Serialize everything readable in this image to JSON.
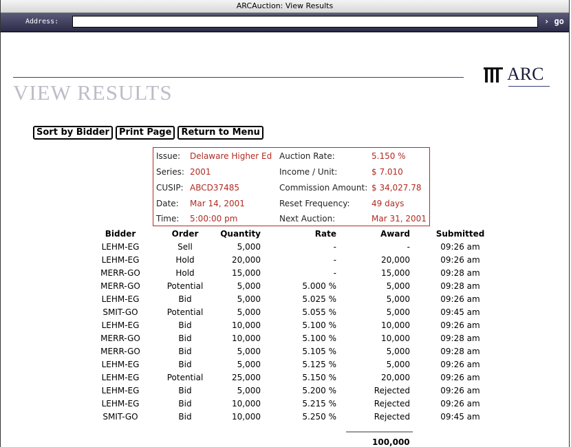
{
  "window": {
    "title": "ARCAuction: View Results"
  },
  "addressbar": {
    "label": "Address:",
    "value": "",
    "go_label": "› go"
  },
  "logo": {
    "text": "ARC"
  },
  "page": {
    "heading": "VIEW RESULTS"
  },
  "buttons": {
    "sort": "Sort by Bidder",
    "print": "Print Page",
    "return": "Return to Menu"
  },
  "info": {
    "issue_label": "Issue:",
    "issue": "Delaware Higher Ed",
    "series_label": "Series:",
    "series": "2001",
    "cusip_label": "CUSIP:",
    "cusip": "ABCD37485",
    "date_label": "Date:",
    "date": "Mar 14, 2001",
    "time_label": "Time:",
    "time": "5:00:00 pm",
    "rate_label": "Auction Rate:",
    "rate": "5.150 %",
    "income_label": "Income / Unit:",
    "income": "$ 7.010",
    "commission_label": "Commission Amount:",
    "commission": "$ 34,027.78",
    "reset_label": "Reset Frequency:",
    "reset": "49 days",
    "next_label": "Next Auction:",
    "next": "Mar 31, 2001"
  },
  "table": {
    "headers": [
      "Bidder",
      "Order",
      "Quantity",
      "Rate",
      "Award",
      "Submitted"
    ],
    "rows": [
      [
        "LEHM-EG",
        "Sell",
        "5,000",
        "-",
        "-",
        "09:26 am"
      ],
      [
        "LEHM-EG",
        "Hold",
        "20,000",
        "-",
        "20,000",
        "09:26 am"
      ],
      [
        "MERR-GO",
        "Hold",
        "15,000",
        "-",
        "15,000",
        "09:28 am"
      ],
      [
        "MERR-GO",
        "Potential",
        "5,000",
        "5.000 %",
        "5,000",
        "09:28 am"
      ],
      [
        "LEHM-EG",
        "Bid",
        "5,000",
        "5.025 %",
        "5,000",
        "09:26 am"
      ],
      [
        "SMIT-GO",
        "Potential",
        "5,000",
        "5.055 %",
        "5,000",
        "09:45 am"
      ],
      [
        "LEHM-EG",
        "Bid",
        "10,000",
        "5.100 %",
        "10,000",
        "09:26 am"
      ],
      [
        "MERR-GO",
        "Bid",
        "10,000",
        "5.100 %",
        "10,000",
        "09:28 am"
      ],
      [
        "MERR-GO",
        "Bid",
        "5,000",
        "5.105 %",
        "5,000",
        "09:28 am"
      ],
      [
        "LEHM-EG",
        "Bid",
        "5,000",
        "5.125 %",
        "5,000",
        "09:26 am"
      ],
      [
        "LEHM-EG",
        "Potential",
        "25,000",
        "5.150 %",
        "20,000",
        "09:26 am"
      ],
      [
        "LEHM-EG",
        "Bid",
        "5,000",
        "5.200 %",
        "Rejected",
        "09:26 am"
      ],
      [
        "LEHM-EG",
        "Bid",
        "10,000",
        "5.215 %",
        "Rejected",
        "09:26 am"
      ],
      [
        "SMIT-GO",
        "Bid",
        "10,000",
        "5.250 %",
        "Rejected",
        "09:45 am"
      ]
    ],
    "total": "100,000"
  }
}
